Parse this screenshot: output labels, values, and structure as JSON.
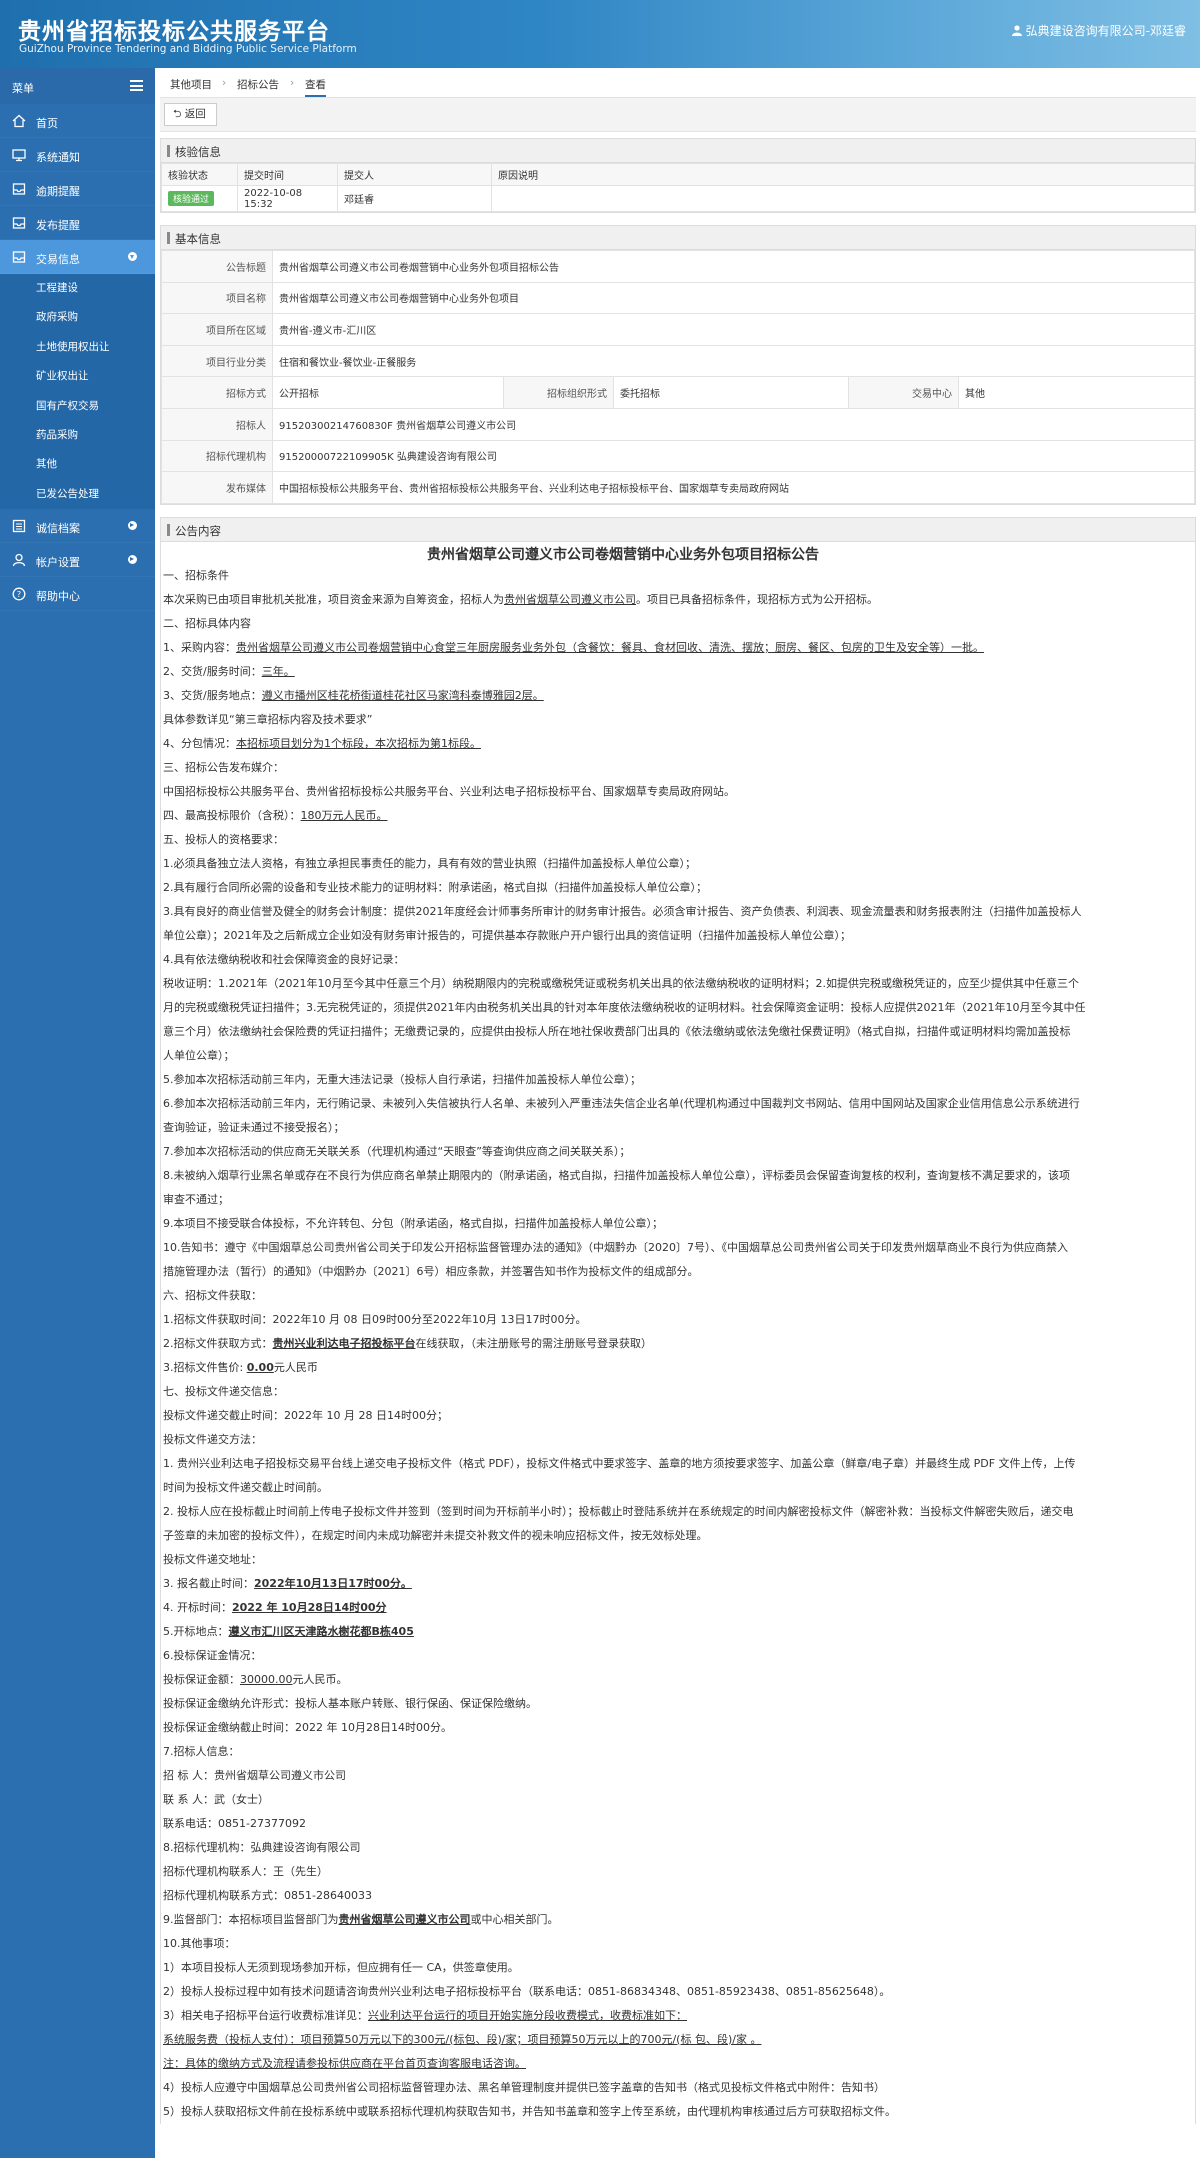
{
  "header": {
    "title_cn": "贵州省招标投标公共服务平台",
    "title_en": "GuiZhou Province Tendering and Bidding Public Service Platform",
    "user": "弘典建设咨询有限公司-邓廷睿"
  },
  "sidebar": {
    "title": "菜单",
    "items": [
      {
        "label": "首页",
        "icon": "home-icon"
      },
      {
        "label": "系统通知",
        "icon": "monitor-icon"
      },
      {
        "label": "逾期提醒",
        "icon": "inbox-icon"
      },
      {
        "label": "发布提醒",
        "icon": "inbox-icon"
      },
      {
        "label": "交易信息",
        "icon": "inbox-icon"
      },
      {
        "label": "诚信档案",
        "icon": "list-icon"
      },
      {
        "label": "帐户设置",
        "icon": "user-icon"
      },
      {
        "label": "帮助中心",
        "icon": "help-icon"
      }
    ],
    "sub_items": [
      "工程建设",
      "政府采购",
      "土地使用权出让",
      "矿业权出让",
      "国有产权交易",
      "药品采购",
      "其他",
      "已发公告处理"
    ]
  },
  "breadcrumb": [
    "其他项目",
    "招标公告",
    "查看"
  ],
  "back_label": "返回",
  "verify": {
    "title": "核验信息",
    "headers": [
      "核验状态",
      "提交时间",
      "提交人",
      "原因说明"
    ],
    "row": {
      "status": "核验通过",
      "time": "2022-10-08 15:32",
      "submitter": "邓廷睿",
      "reason": ""
    }
  },
  "basic": {
    "title": "基本信息",
    "announcement_title_label": "公告标题",
    "announcement_title": "贵州省烟草公司遵义市公司卷烟营销中心业务外包项目招标公告",
    "project_name_label": "项目名称",
    "project_name": "贵州省烟草公司遵义市公司卷烟营销中心业务外包项目",
    "region_label": "项目所在区域",
    "region": "贵州省-遵义市-汇川区",
    "industry_label": "项目行业分类",
    "industry": "住宿和餐饮业-餐饮业-正餐服务",
    "method_label": "招标方式",
    "method": "公开招标",
    "org_form_label": "招标组织形式",
    "org_form": "委托招标",
    "center_label": "交易中心",
    "center": "其他",
    "tenderer_label": "招标人",
    "tenderer": "91520300214760830F 贵州省烟草公司遵义市公司",
    "agent_label": "招标代理机构",
    "agent": "91520000722109905K 弘典建设咨询有限公司",
    "media_label": "发布媒体",
    "media": "中国招标投标公共服务平台、贵州省招标投标公共服务平台、兴业利达电子招标投标平台、国家烟草专卖局政府网站"
  },
  "announcement": {
    "title": "公告内容",
    "heading": "贵州省烟草公司遵义市公司卷烟营销中心业务外包项目招标公告",
    "lines": [
      [
        {
          "t": "一、招标条件"
        }
      ],
      [
        {
          "t": "本次采购已由项目审批机关批准，项目资金来源为自筹资金，招标人为"
        },
        {
          "t": "贵州省烟草公司遵义市公司",
          "s": "u"
        },
        {
          "t": "。项目已具备招标条件，现招标方式为公开招标。"
        }
      ],
      [
        {
          "t": "二、招标具体内容"
        }
      ],
      [
        {
          "t": "1、采购内容："
        },
        {
          "t": "贵州省烟草公司遵义市公司卷烟营销中心食堂三年厨房服务业务外包（含餐饮：餐具、食材回收、清洗、摆放；厨房、餐区、包房的卫生及安全等）一批。",
          "s": "u"
        }
      ],
      [
        {
          "t": "2、交货/服务时间："
        },
        {
          "t": "三年。",
          "s": "u"
        }
      ],
      [
        {
          "t": "3、交货/服务地点："
        },
        {
          "t": "遵义市播州区桂花桥街道桂花社区马家湾科泰博雅园2层。",
          "s": "u"
        }
      ],
      [
        {
          "t": "具体参数详见“第三章招标内容及技术要求”",
          "s": "b"
        }
      ],
      [
        {
          "t": "4、分包情况："
        },
        {
          "t": "本招标项目划分为1个标段，本次招标为第1标段。",
          "s": "u"
        }
      ],
      [
        {
          "t": "三、招标公告发布媒介："
        }
      ],
      [
        {
          "t": "中国招标投标公共服务平台、贵州省招标投标公共服务平台、兴业利达电子招标投标平台、国家烟草专卖局政府网站。"
        }
      ],
      [
        {
          "t": "四、最高投标限价（含税）："
        },
        {
          "t": "180万元人民币。",
          "s": "u"
        }
      ],
      [
        {
          "t": "五、投标人的资格要求："
        }
      ],
      [
        {
          "t": "1.必须具备独立法人资格，有独立承担民事责任的能力，具有有效的营业执照（扫描件加盖投标人单位公章）；"
        }
      ],
      [
        {
          "t": "2.具有履行合同所必需的设备和专业技术能力的证明材料：附承诺函，格式自拟（扫描件加盖投标人单位公章）；"
        }
      ],
      [
        {
          "t": "3.具有良好的商业信誉及健全的财务会计制度：提供2021年度经会计师事务所审计的财务审计报告。必须含审计报告、资产负债表、利润表、现金流量表和财务报表附注（扫描件加盖投标人"
        }
      ],
      [
        {
          "t": "单位公章）；2021年及之后新成立企业如没有财务审计报告的，可提供基本存款账户开户银行出具的资信证明（扫描件加盖投标人单位公章）；"
        }
      ],
      [
        {
          "t": "4.具有依法缴纳税收和社会保障资金的良好记录："
        }
      ],
      [
        {
          "t": "税收证明：1.2021年（2021年10月至今其中任意三个月）纳税期限内的完税或缴税凭证或税务机关出具的依法缴纳税收的证明材料；2.如提供完税或缴税凭证的，应至少提供其中任意三个"
        }
      ],
      [
        {
          "t": "月的完税或缴税凭证扫描件；3.无完税凭证的，须提供2021年内由税务机关出具的针对本年度依法缴纳税收的证明材料。社会保障资金证明：投标人应提供2021年（2021年10月至今其中任"
        }
      ],
      [
        {
          "t": "意三个月）依法缴纳社会保险费的凭证扫描件；无缴费记录的，应提供由投标人所在地社保收费部门出具的《依法缴纳或依法免缴社保费证明》（格式自拟，扫描件或证明材料均需加盖投标"
        }
      ],
      [
        {
          "t": "人单位公章）；"
        }
      ],
      [
        {
          "t": "5.参加本次招标活动前三年内，无重大违法记录（投标人自行承诺，扫描件加盖投标人单位公章）；"
        }
      ],
      [
        {
          "t": "6.参加本次招标活动前三年内，无行贿记录、未被列入失信被执行人名单、未被列入严重违法失信企业名单(代理机构通过中国裁判文书网站、信用中国网站及国家企业信用信息公示系统进行"
        }
      ],
      [
        {
          "t": "查询验证，验证未通过不接受报名）；"
        }
      ],
      [
        {
          "t": "7.参加本次招标活动的供应商无关联关系（代理机构通过“天眼查”等查询供应商之间关联关系）；"
        }
      ],
      [
        {
          "t": "8.未被纳入烟草行业黑名单或存在不良行为供应商名单禁止期限内的（附承诺函，格式自拟，扫描件加盖投标人单位公章），评标委员会保留查询复核的权利，查询复核不满足要求的，该项"
        }
      ],
      [
        {
          "t": "审查不通过；"
        }
      ],
      [
        {
          "t": "9.本项目不接受联合体投标，不允许转包、分包（附承诺函，格式自拟，扫描件加盖投标人单位公章）；"
        }
      ],
      [
        {
          "t": "10.告知书：遵守《中国烟草总公司贵州省公司关于印发公开招标监督管理办法的通知》（中烟黔办〔2020〕7号）、《中国烟草总公司贵州省公司关于印发贵州烟草商业不良行为供应商禁入"
        }
      ],
      [
        {
          "t": "措施管理办法（暂行）的通知》（中烟黔办〔2021〕6号）相应条款，并签署告知书作为投标文件的组成部分。"
        }
      ],
      [
        {
          "t": "六、招标文件获取："
        }
      ],
      [
        {
          "t": "1.招标文件获取时间：2022年10 月 08 日09时00分至2022年10月 13日17时00分。"
        }
      ],
      [
        {
          "t": "2.招标文件获取方式："
        },
        {
          "t": "贵州兴业利达电子招投标平台",
          "s": "ub"
        },
        {
          "t": "在线获取，（未注册账号的需注册账号登录获取）"
        }
      ],
      [
        {
          "t": "3.招标文件售价: "
        },
        {
          "t": "0.00",
          "s": "ub"
        },
        {
          "t": "元人民币"
        }
      ],
      [
        {
          "t": "七、投标文件递交信息："
        }
      ],
      [
        {
          "t": "投标文件递交截止时间："
        },
        {
          "t": "2022年 10 月 28 日14时00分",
          "s": "b"
        },
        {
          "t": "；"
        }
      ],
      [
        {
          "t": "投标文件递交方法："
        }
      ],
      [
        {
          "t": "1. 贵州兴业利达电子招投标交易平台线上递交电子投标文件（格式 PDF），投标文件格式中要求签字、盖章的地方须按要求签字、加盖公章（鲜章/电子章）并最终生成 PDF 文件上传，上传"
        }
      ],
      [
        {
          "t": "时间为投标文件递交截止时间前。"
        }
      ],
      [
        {
          "t": "2. 投标人应在投标截止时间前上传电子投标文件并签到（签到时间为开标前半小时）；投标截止时登陆系统并在系统规定的时间内解密投标文件（解密补救：当投标文件解密失败后，递交电"
        }
      ],
      [
        {
          "t": "子签章的未加密的投标文件），在规定时间内未成功解密并未提交补救文件的视未响应招标文件，按无效标处理。"
        }
      ],
      [
        {
          "t": "投标文件递交地址："
        }
      ],
      [
        {
          "t": "3. 报名截止时间：",
          "s": "b"
        },
        {
          "t": "2022年10月13日17时00分。",
          "s": "ub"
        }
      ],
      [
        {
          "t": "4. 开标时间：",
          "s": "b"
        },
        {
          "t": "2022 年 10月28日14时00分",
          "s": "ub"
        }
      ],
      [
        {
          "t": "5.开标地点：",
          "s": "b"
        },
        {
          "t": "遵义市汇川区天津路水榭花都B栋405",
          "s": "ub"
        }
      ],
      [
        {
          "t": "6.投标保证金情况："
        }
      ],
      [
        {
          "t": "投标保证金额："
        },
        {
          "t": "30000.00",
          "s": "u"
        },
        {
          "t": "元人民币。"
        }
      ],
      [
        {
          "t": "投标保证金缴纳允许形式：投标人基本账户转账、银行保函、保证保险缴纳。"
        }
      ],
      [
        {
          "t": "投标保证金缴纳截止时间："
        },
        {
          "t": "2022 年 10月28日14时00分",
          "s": "b"
        },
        {
          "t": "。"
        }
      ],
      [
        {
          "t": "7.招标人信息："
        }
      ],
      [
        {
          "t": "招 标 人：贵州省烟草公司遵义市公司"
        }
      ],
      [
        {
          "t": "联 系 人：武（女士）"
        }
      ],
      [
        {
          "t": "联系电话：0851-27377092"
        }
      ],
      [
        {
          "t": "8.招标代理机构：弘典建设咨询有限公司"
        }
      ],
      [
        {
          "t": "招标代理机构联系人：王（先生）"
        }
      ],
      [
        {
          "t": "招标代理机构联系方式：0851-28640033"
        }
      ],
      [
        {
          "t": "9.监督部门：本招标项目监督部门为"
        },
        {
          "t": "贵州省烟草公司遵义市公司",
          "s": "ub"
        },
        {
          "t": "或中心相关部门。"
        }
      ],
      [
        {
          "t": "10.其他事项："
        }
      ],
      [
        {
          "t": "1）本项目投标人无须到现场参加开标，但应拥有任一 CA，供签章使用。"
        }
      ],
      [
        {
          "t": "2）投标人投标过程中如有技术问题请咨询贵州兴业利达电子招标投标平台（联系电话：0851-86834348、0851-85923438、0851-85625648）。"
        }
      ],
      [
        {
          "t": "3）相关电子招标平台运行收费标准详见："
        },
        {
          "t": "兴业利达平台运行的项目开始实施分段收费模式，收费标准如下：",
          "s": "u"
        }
      ],
      [
        {
          "t": "系统服务费（投标人支付）：项目预算50万元以下的300元/(标包、段)/家；项目预算50万元以上的700元/(标 包、段)/家 。",
          "s": "u"
        }
      ],
      [
        {
          "t": "注：具体的缴纳方式及流程请参投标供应商在平台首页查询客服电话咨询。",
          "s": "u"
        }
      ],
      [
        {
          "t": "4）投标人应遵守中国烟草总公司贵州省公司招标监督管理办法、黑名单管理制度并提供已签字盖章的告知书（格式见投标文件格式中附件：告知书）"
        }
      ],
      [
        {
          "t": "5）投标人获取招标文件前在投标系统中或联系招标代理机构获取告知书，并告知书盖章和签字上传至系统，由代理机构审核通过后方可获取招标文件。"
        }
      ]
    ]
  }
}
